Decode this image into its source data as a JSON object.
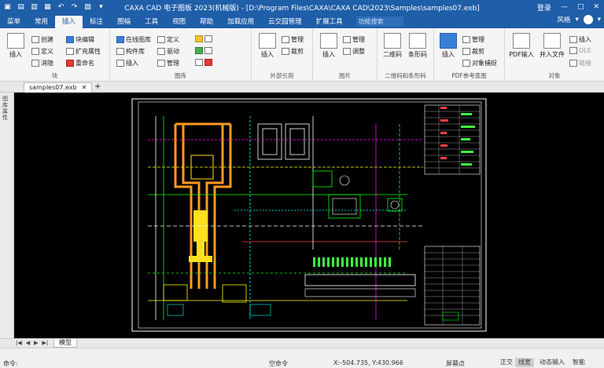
{
  "titlebar": {
    "title": "CAXA CAD 电子图板 2023(机械版) - [D:\\Program Files\\CAXA\\CAXA CAD\\2023\\Samples\\samples07.exb]",
    "login": "登录",
    "minimize": "—",
    "maximize": "□",
    "close": "✕"
  },
  "menu": {
    "tabs": [
      "菜单",
      "常用",
      "插入",
      "标注",
      "图幅",
      "工具",
      "视图",
      "帮助",
      "加载应用",
      "云交园管理",
      "扩展工具"
    ],
    "active_index": 2,
    "search_placeholder": "功能搜索",
    "style_label": "风格"
  },
  "ribbon": {
    "block": {
      "label": "块",
      "insert": "插入",
      "create": "创建",
      "edit_block": "块编辑",
      "define": "定义",
      "extend_attr": "扩充属性",
      "dissolve": "消隐",
      "rename": "重命名"
    },
    "library": {
      "label": "图库",
      "online": "在线图库",
      "component": "构件库",
      "insert": "插入",
      "define": "定义",
      "drive": "驱动",
      "manage": "管理"
    },
    "external": {
      "label": "外部引用",
      "insert": "插入",
      "manage": "管理",
      "clip": "裁剪"
    },
    "image": {
      "label": "图片",
      "insert": "插入",
      "manage": "管理",
      "adjust": "调整"
    },
    "barcode": {
      "label": "二维码和条形码",
      "qrcode": "二维码",
      "barcode": "条形码"
    },
    "pdf": {
      "label": "PDF参考底图",
      "insert": "插入",
      "manage": "管理",
      "clip": "裁剪",
      "snap": "对象捕捉"
    },
    "object": {
      "label": "对象",
      "pdf_input": "PDF输入",
      "other_file": "并入文件",
      "insert": "插入",
      "ole": "OLE",
      "link": "链接"
    }
  },
  "document": {
    "tab_name": "samples07.exb",
    "close": "✕",
    "add": "+",
    "model_tab": "模型"
  },
  "left_panel": {
    "text": "图库 属性"
  },
  "bottom_nav": [
    "|◀",
    "◀",
    "▶",
    "▶|"
  ],
  "status": {
    "command_label": "命令:",
    "idle": "空命令",
    "coords": "X:-504.735, Y:430.966",
    "screen_point": "屏幕点",
    "ortho": "正交",
    "linewidth": "线宽",
    "dyn_input": "动态输入",
    "smart": "智能"
  }
}
